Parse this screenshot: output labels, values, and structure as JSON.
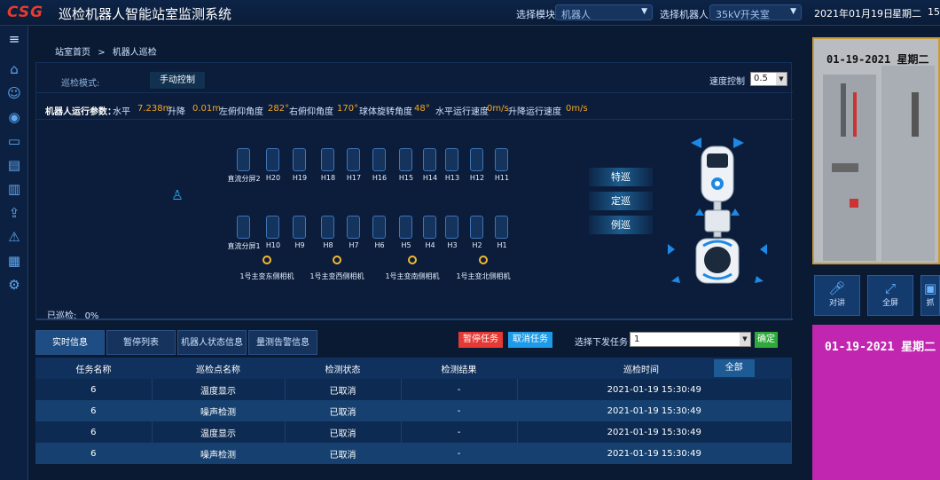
{
  "app": {
    "logo": "CSG",
    "title": "巡检机器人智能站室监测系统"
  },
  "header": {
    "module_label": "选择模块",
    "module_value": "机器人",
    "robot_label": "选择机器人",
    "robot_value": "35kV开关室",
    "date": "2021年01月19日",
    "weekday": "星期二",
    "time": "15"
  },
  "breadcrumb": {
    "home": "站室首页",
    "sep": ">",
    "current": "机器人巡检"
  },
  "control": {
    "mode_label": "巡检模式:",
    "mode_value": "手动控制",
    "speed_label": "速度控制",
    "speed_value": "0.5"
  },
  "params": {
    "title": "机器人运行参数：",
    "items": [
      {
        "label": "水平",
        "value": "7.238m"
      },
      {
        "label": "升降",
        "value": "0.01m"
      },
      {
        "label": "左俯仰角度",
        "value": "282°"
      },
      {
        "label": "右俯仰角度",
        "value": "170°"
      },
      {
        "label": "球体旋转角度",
        "value": "48°"
      },
      {
        "label": "水平运行速度",
        "value": "0m/s"
      },
      {
        "label": "升降运行速度",
        "value": "0m/s"
      }
    ]
  },
  "cabinets": {
    "top": [
      "直流分屏2",
      "H20",
      "H19",
      "H18",
      "H17",
      "H16",
      "H15",
      "H14",
      "H13",
      "H12",
      "H11"
    ],
    "bottom": [
      "直流分屏1",
      "H10",
      "H9",
      "H8",
      "H7",
      "H6",
      "H5",
      "H4",
      "H3",
      "H2",
      "H1"
    ]
  },
  "sensors": [
    "1号主变东侧相机",
    "1号主变西侧相机",
    "1号主变南侧相机",
    "1号主变北侧相机"
  ],
  "modes": [
    "特巡",
    "定巡",
    "例巡"
  ],
  "progress": {
    "label": "已巡检:",
    "value": "0%",
    "percent": 0
  },
  "camera": {
    "timestamp": "01-19-2021  星期二",
    "controls": [
      {
        "icon": "mic-icon",
        "label": "对讲"
      },
      {
        "icon": "fullscreen-icon",
        "label": "全屏"
      },
      {
        "icon": "camera-icon",
        "label": "抓"
      }
    ]
  },
  "camera2": {
    "timestamp": "01-19-2021  星期二"
  },
  "tabs": [
    "实时信息",
    "暂停列表",
    "机器人状态信息",
    "量测告警信息"
  ],
  "actions": {
    "pause": "暂停任务",
    "cancel": "取消任务",
    "task_label": "选择下发任务",
    "task_value": "1",
    "confirm": "确定"
  },
  "table": {
    "headers": [
      "任务名称",
      "巡检点名称",
      "检测状态",
      "检测结果",
      "巡检时间"
    ],
    "all_button": "全部",
    "rows": [
      [
        "6",
        "温度显示",
        "已取消",
        "-",
        "2021-01-19 15:30:49"
      ],
      [
        "6",
        "噪声检测",
        "已取消",
        "-",
        "2021-01-19 15:30:49"
      ],
      [
        "6",
        "温度显示",
        "已取消",
        "-",
        "2021-01-19 15:30:49"
      ],
      [
        "6",
        "噪声检测",
        "已取消",
        "-",
        "2021-01-19 15:30:49"
      ]
    ]
  },
  "colors": {
    "accent": "#f5a623",
    "pause": "#e53935",
    "cancel": "#1e9be8",
    "confirm": "#2eaa3b",
    "magenta": "#c026b0"
  }
}
